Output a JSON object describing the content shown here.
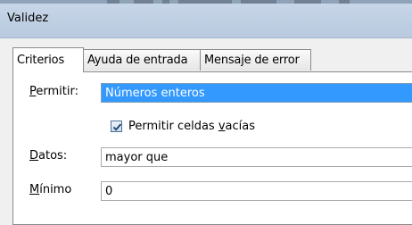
{
  "dialog": {
    "title": "Validez"
  },
  "tabs": [
    {
      "label": "Criterios"
    },
    {
      "label": "Ayuda de entrada"
    },
    {
      "label": "Mensaje de error"
    }
  ],
  "criteria": {
    "allow": {
      "label_key": "P",
      "label_rest": "ermitir:",
      "value": "Números enteros"
    },
    "ignore_blank": {
      "checked": true,
      "label_pre": "Permitir celdas ",
      "label_key": "v",
      "label_post": "acías"
    },
    "data": {
      "label_key": "D",
      "label_rest": "atos:",
      "value": "mayor que"
    },
    "minimum": {
      "label_key": "M",
      "label_rest": "ínimo",
      "value": "0"
    }
  }
}
